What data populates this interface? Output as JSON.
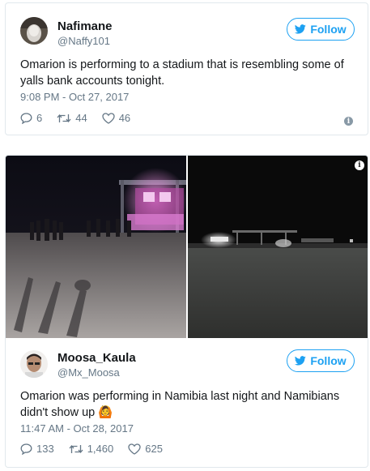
{
  "tweets": [
    {
      "name": "Nafimane",
      "handle": "@Naffy101",
      "follow_label": "Follow",
      "text": "Omarion is performing to a stadium that is resembling some of yalls bank accounts tonight.",
      "time": "9:08 PM - Oct 27, 2017",
      "replies": "6",
      "retweets": "44",
      "likes": "46"
    },
    {
      "name": "Moosa_Kaula",
      "handle": "@Mx_Moosa",
      "follow_label": "Follow",
      "text": "Omarion was performing in Namibia last night and Namibians didn't show up",
      "emoji": "🙆",
      "time": "11:47 AM - Oct 28, 2017",
      "replies": "133",
      "retweets": "1,460",
      "likes": "625"
    }
  ],
  "colors": {
    "accent": "#1da1f2",
    "muted": "#657786",
    "border": "#e1e8ed"
  }
}
